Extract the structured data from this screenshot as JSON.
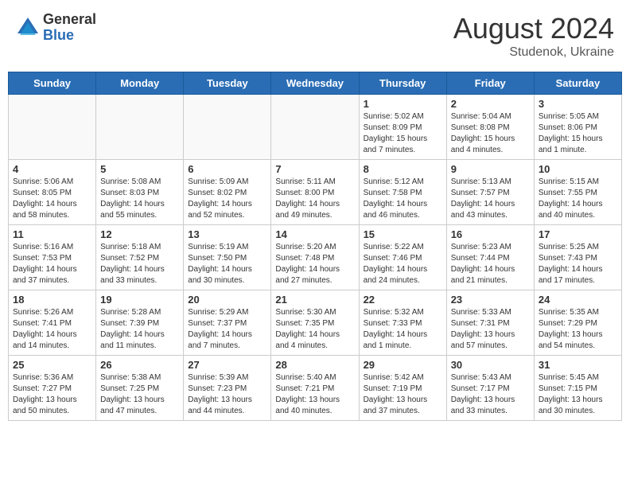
{
  "header": {
    "logo": {
      "general": "General",
      "blue": "Blue"
    },
    "title": "August 2024",
    "location": "Studenok, Ukraine"
  },
  "days_of_week": [
    "Sunday",
    "Monday",
    "Tuesday",
    "Wednesday",
    "Thursday",
    "Friday",
    "Saturday"
  ],
  "weeks": [
    [
      {
        "day": "",
        "info": ""
      },
      {
        "day": "",
        "info": ""
      },
      {
        "day": "",
        "info": ""
      },
      {
        "day": "",
        "info": ""
      },
      {
        "day": "1",
        "info": "Sunrise: 5:02 AM\nSunset: 8:09 PM\nDaylight: 15 hours\nand 7 minutes."
      },
      {
        "day": "2",
        "info": "Sunrise: 5:04 AM\nSunset: 8:08 PM\nDaylight: 15 hours\nand 4 minutes."
      },
      {
        "day": "3",
        "info": "Sunrise: 5:05 AM\nSunset: 8:06 PM\nDaylight: 15 hours\nand 1 minute."
      }
    ],
    [
      {
        "day": "4",
        "info": "Sunrise: 5:06 AM\nSunset: 8:05 PM\nDaylight: 14 hours\nand 58 minutes."
      },
      {
        "day": "5",
        "info": "Sunrise: 5:08 AM\nSunset: 8:03 PM\nDaylight: 14 hours\nand 55 minutes."
      },
      {
        "day": "6",
        "info": "Sunrise: 5:09 AM\nSunset: 8:02 PM\nDaylight: 14 hours\nand 52 minutes."
      },
      {
        "day": "7",
        "info": "Sunrise: 5:11 AM\nSunset: 8:00 PM\nDaylight: 14 hours\nand 49 minutes."
      },
      {
        "day": "8",
        "info": "Sunrise: 5:12 AM\nSunset: 7:58 PM\nDaylight: 14 hours\nand 46 minutes."
      },
      {
        "day": "9",
        "info": "Sunrise: 5:13 AM\nSunset: 7:57 PM\nDaylight: 14 hours\nand 43 minutes."
      },
      {
        "day": "10",
        "info": "Sunrise: 5:15 AM\nSunset: 7:55 PM\nDaylight: 14 hours\nand 40 minutes."
      }
    ],
    [
      {
        "day": "11",
        "info": "Sunrise: 5:16 AM\nSunset: 7:53 PM\nDaylight: 14 hours\nand 37 minutes."
      },
      {
        "day": "12",
        "info": "Sunrise: 5:18 AM\nSunset: 7:52 PM\nDaylight: 14 hours\nand 33 minutes."
      },
      {
        "day": "13",
        "info": "Sunrise: 5:19 AM\nSunset: 7:50 PM\nDaylight: 14 hours\nand 30 minutes."
      },
      {
        "day": "14",
        "info": "Sunrise: 5:20 AM\nSunset: 7:48 PM\nDaylight: 14 hours\nand 27 minutes."
      },
      {
        "day": "15",
        "info": "Sunrise: 5:22 AM\nSunset: 7:46 PM\nDaylight: 14 hours\nand 24 minutes."
      },
      {
        "day": "16",
        "info": "Sunrise: 5:23 AM\nSunset: 7:44 PM\nDaylight: 14 hours\nand 21 minutes."
      },
      {
        "day": "17",
        "info": "Sunrise: 5:25 AM\nSunset: 7:43 PM\nDaylight: 14 hours\nand 17 minutes."
      }
    ],
    [
      {
        "day": "18",
        "info": "Sunrise: 5:26 AM\nSunset: 7:41 PM\nDaylight: 14 hours\nand 14 minutes."
      },
      {
        "day": "19",
        "info": "Sunrise: 5:28 AM\nSunset: 7:39 PM\nDaylight: 14 hours\nand 11 minutes."
      },
      {
        "day": "20",
        "info": "Sunrise: 5:29 AM\nSunset: 7:37 PM\nDaylight: 14 hours\nand 7 minutes."
      },
      {
        "day": "21",
        "info": "Sunrise: 5:30 AM\nSunset: 7:35 PM\nDaylight: 14 hours\nand 4 minutes."
      },
      {
        "day": "22",
        "info": "Sunrise: 5:32 AM\nSunset: 7:33 PM\nDaylight: 14 hours\nand 1 minute."
      },
      {
        "day": "23",
        "info": "Sunrise: 5:33 AM\nSunset: 7:31 PM\nDaylight: 13 hours\nand 57 minutes."
      },
      {
        "day": "24",
        "info": "Sunrise: 5:35 AM\nSunset: 7:29 PM\nDaylight: 13 hours\nand 54 minutes."
      }
    ],
    [
      {
        "day": "25",
        "info": "Sunrise: 5:36 AM\nSunset: 7:27 PM\nDaylight: 13 hours\nand 50 minutes."
      },
      {
        "day": "26",
        "info": "Sunrise: 5:38 AM\nSunset: 7:25 PM\nDaylight: 13 hours\nand 47 minutes."
      },
      {
        "day": "27",
        "info": "Sunrise: 5:39 AM\nSunset: 7:23 PM\nDaylight: 13 hours\nand 44 minutes."
      },
      {
        "day": "28",
        "info": "Sunrise: 5:40 AM\nSunset: 7:21 PM\nDaylight: 13 hours\nand 40 minutes."
      },
      {
        "day": "29",
        "info": "Sunrise: 5:42 AM\nSunset: 7:19 PM\nDaylight: 13 hours\nand 37 minutes."
      },
      {
        "day": "30",
        "info": "Sunrise: 5:43 AM\nSunset: 7:17 PM\nDaylight: 13 hours\nand 33 minutes."
      },
      {
        "day": "31",
        "info": "Sunrise: 5:45 AM\nSunset: 7:15 PM\nDaylight: 13 hours\nand 30 minutes."
      }
    ]
  ]
}
